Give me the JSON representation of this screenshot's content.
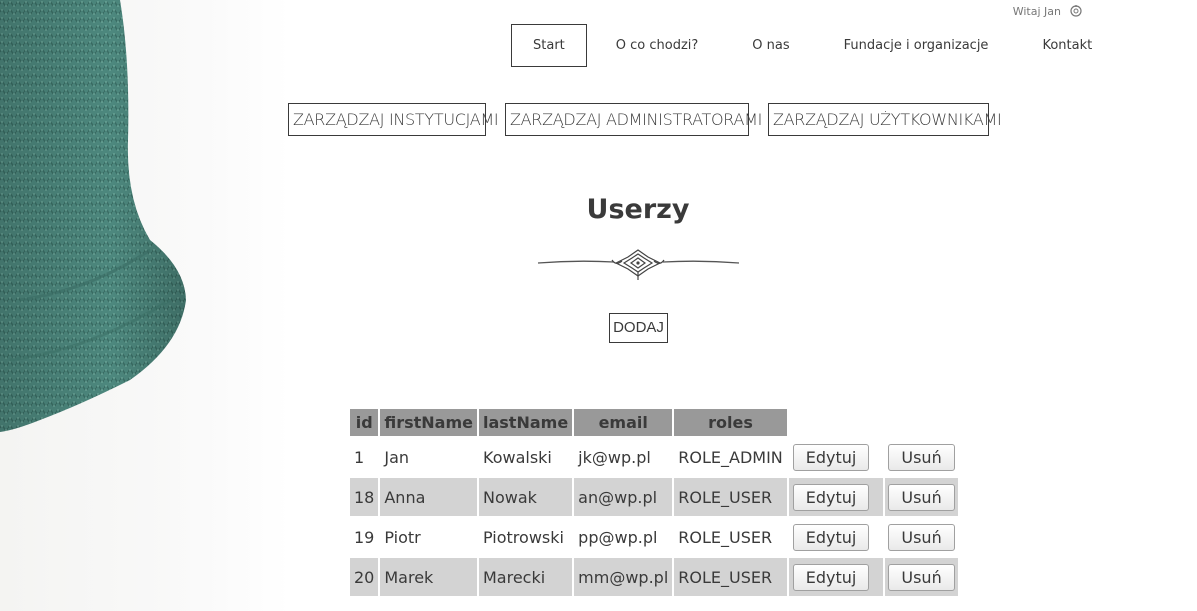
{
  "header": {
    "greeting": "Witaj Jan",
    "logout_icon": "power-icon"
  },
  "nav": {
    "items": [
      {
        "label": "Start",
        "active": true
      },
      {
        "label": "O co chodzi?",
        "active": false
      },
      {
        "label": "O nas",
        "active": false
      },
      {
        "label": "Fundacje i organizacje",
        "active": false
      },
      {
        "label": "Kontakt",
        "active": false
      }
    ]
  },
  "admin": {
    "institutions_label": "ZARZĄDZAJ INSTYTUCJAMI",
    "admins_label": "ZARZĄDZAJ ADMINISTRATORAMI",
    "users_label": "ZARZĄDZAJ UŻYTKOWNIKAMI"
  },
  "main": {
    "title": "Userzy",
    "add_label": "DODAJ"
  },
  "table": {
    "columns": [
      "id",
      "firstName",
      "lastName",
      "email",
      "roles"
    ],
    "rows": [
      {
        "id": "1",
        "firstName": "Jan",
        "lastName": "Kowalski",
        "email": "jk@wp.pl",
        "roles": "ROLE_ADMIN"
      },
      {
        "id": "18",
        "firstName": "Anna",
        "lastName": "Nowak",
        "email": "an@wp.pl",
        "roles": "ROLE_USER"
      },
      {
        "id": "19",
        "firstName": "Piotr",
        "lastName": "Piotrowski",
        "email": "pp@wp.pl",
        "roles": "ROLE_USER"
      },
      {
        "id": "20",
        "firstName": "Marek",
        "lastName": "Marecki",
        "email": "mm@wp.pl",
        "roles": "ROLE_USER"
      }
    ],
    "edit_label": "Edytuj",
    "delete_label": "Usuń"
  },
  "colors": {
    "text": "#3a3a3a",
    "table_header": "#999999",
    "row_alt": "#d3d3d3",
    "sweater": "#4f8a80"
  }
}
